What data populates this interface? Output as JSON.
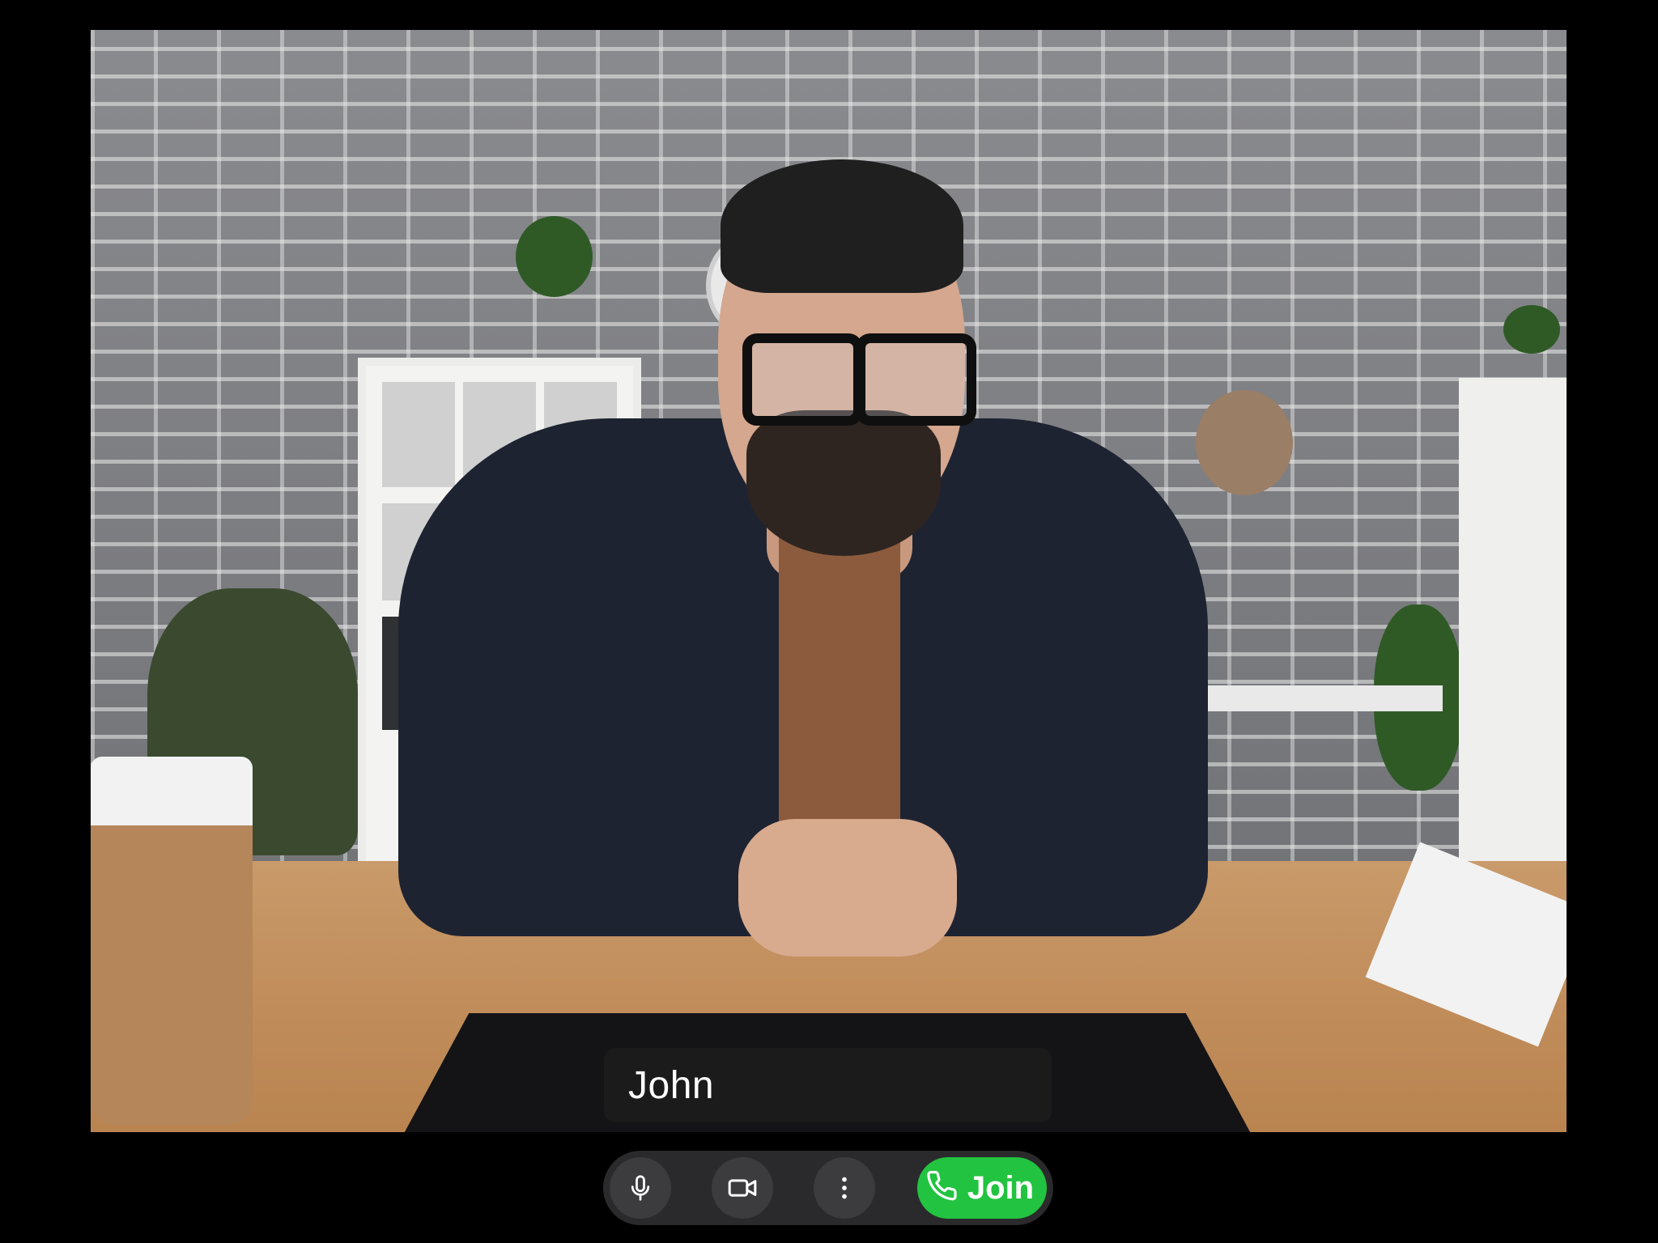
{
  "video": {
    "participant_name": "John"
  },
  "controls": {
    "microphone_icon": "microphone-icon",
    "camera_icon": "video-camera-icon",
    "more_icon": "more-vertical-icon",
    "join_icon": "phone-icon",
    "join_label": "Join"
  },
  "colors": {
    "background": "#000000",
    "control_bar": "#2a2a2c",
    "control_button": "#3c3c3e",
    "join_button": "#22c340",
    "text": "#ffffff"
  }
}
